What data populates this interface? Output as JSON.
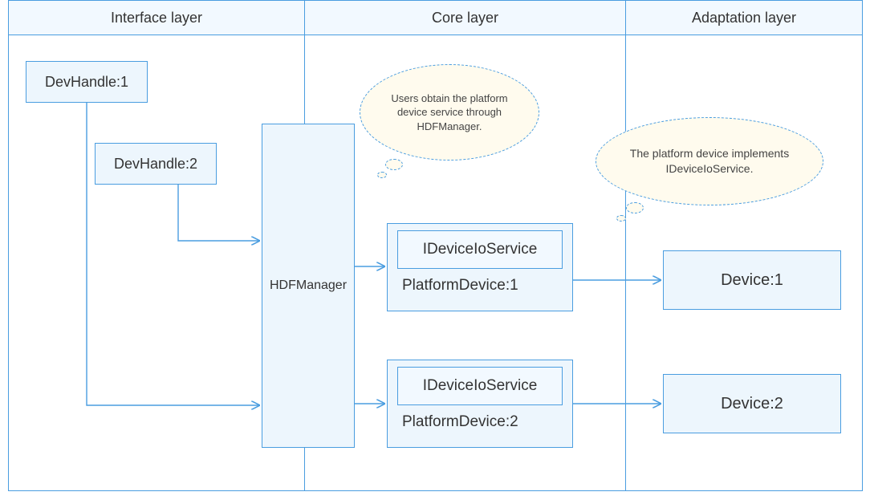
{
  "headers": {
    "interface": "Interface layer",
    "core": "Core layer",
    "adaptation": "Adaptation layer"
  },
  "interface": {
    "devhandle1": "DevHandle:1",
    "devhandle2": "DevHandle:2"
  },
  "core": {
    "hdfmanager": "HDFManager",
    "io_service_label": "IDeviceIoService",
    "platform_device1": "PlatformDevice:1",
    "platform_device2": "PlatformDevice:2",
    "bubble1": "Users obtain the platform device service through HDFManager.",
    "bubble2": "The platform device implements IDeviceIoService."
  },
  "adaptation": {
    "device1": "Device:1",
    "device2": "Device:2"
  },
  "colors": {
    "stroke": "#4a9de0",
    "box_fill": "#edf6fd",
    "header_fill": "#f2f9ff",
    "bubble_fill": "#fffbee"
  }
}
